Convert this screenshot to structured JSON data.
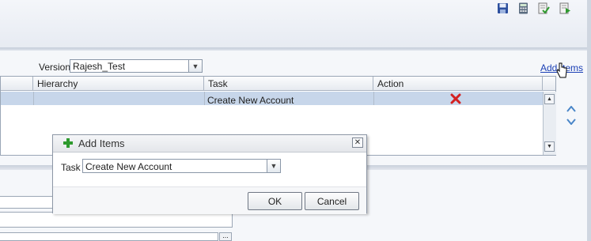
{
  "toolbar": {
    "icons": [
      "save-icon",
      "calculator-icon",
      "validate-icon",
      "submit-icon"
    ]
  },
  "version": {
    "label": "Version",
    "value": "Rajesh_Test"
  },
  "add_items_link": "Add Items",
  "table": {
    "columns": [
      "Hierarchy",
      "Task",
      "Action"
    ],
    "rows": [
      {
        "hierarchy": "",
        "task": "Create New Account",
        "action": "delete-icon"
      }
    ]
  },
  "dialog": {
    "title": "Add Items",
    "task_label": "Task",
    "task_value": "Create New Account",
    "ok_label": "OK",
    "cancel_label": "Cancel"
  },
  "lower": {
    "ellipsis": "..."
  },
  "colors": {
    "accent": "#1a3fb5",
    "selected_row": "#c7d6ea",
    "delete": "#d42020",
    "add": "#2e9a2e"
  }
}
